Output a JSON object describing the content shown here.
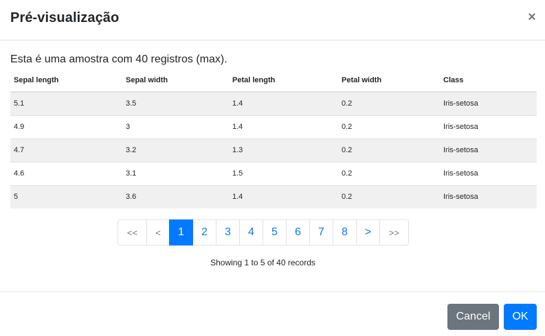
{
  "modal": {
    "title": "Pré-visualização",
    "close_symbol": "×",
    "close_icon": "close-icon"
  },
  "intro_text": "Esta é uma amostra com 40 registros (max).",
  "table": {
    "headers": [
      "Sepal length",
      "Sepal width",
      "Petal length",
      "Petal width",
      "Class"
    ],
    "rows": [
      [
        "5.1",
        "3.5",
        "1.4",
        "0.2",
        "Iris-setosa"
      ],
      [
        "4.9",
        "3",
        "1.4",
        "0.2",
        "Iris-setosa"
      ],
      [
        "4.7",
        "3.2",
        "1.3",
        "0.2",
        "Iris-setosa"
      ],
      [
        "4.6",
        "3.1",
        "1.5",
        "0.2",
        "Iris-setosa"
      ],
      [
        "5",
        "3.6",
        "1.4",
        "0.2",
        "Iris-setosa"
      ]
    ]
  },
  "pagination": {
    "first": "<<",
    "prev": "<",
    "pages": [
      "1",
      "2",
      "3",
      "4",
      "5",
      "6",
      "7",
      "8"
    ],
    "active_page": "1",
    "next": ">",
    "last": ">>"
  },
  "records_text": "Showing 1 to 5 of 40 records",
  "footer": {
    "cancel_label": "Cancel",
    "ok_label": "OK"
  },
  "colors": {
    "primary": "#007bff",
    "secondary": "#6c757d",
    "stripe": "#f0f0f0",
    "border": "#dee2e6"
  }
}
